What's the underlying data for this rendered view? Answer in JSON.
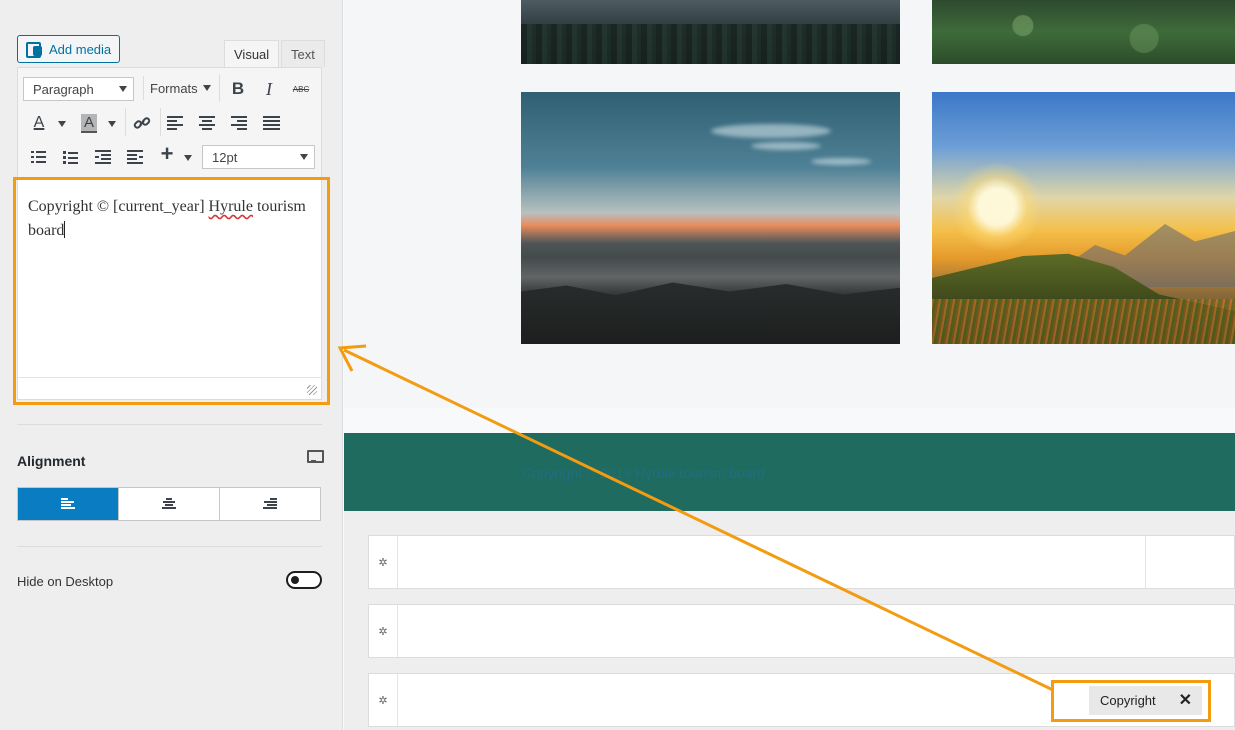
{
  "editor": {
    "add_media_label": "Add media",
    "tabs": [
      {
        "label": "Visual"
      },
      {
        "label": "Text"
      }
    ],
    "toolbar": {
      "paragraph_select": "Paragraph",
      "formats_label": "Formats",
      "font_size_select": "12pt",
      "icons": [
        "bold-icon",
        "italic-icon",
        "strikethrough-icon",
        "text-color-icon",
        "background-color-icon",
        "link-icon",
        "align-left-icon",
        "align-center-icon",
        "align-right-icon",
        "align-justify-icon",
        "ordered-list-icon",
        "bullet-list-icon",
        "outdent-icon",
        "indent-icon",
        "insert-icon"
      ],
      "bold_glyph": "B",
      "italic_glyph": "I",
      "strike_glyph": "ABC",
      "text_color_glyph": "A",
      "bg_color_glyph": "A",
      "insert_glyph": "+"
    },
    "content": {
      "part1": "Copyright © [current_year] ",
      "misspelled": "Hyrule",
      "part2": " tourism board"
    }
  },
  "alignment": {
    "title": "Alignment",
    "options": [
      "left",
      "center",
      "right"
    ],
    "selected": "left"
  },
  "visibility": {
    "hide_on_desktop_label": "Hide on Desktop",
    "hide_on_desktop": false
  },
  "preview": {
    "footer_text": "Copyright © 2019 Hyrule tourism board",
    "chip_label": "Copyright",
    "chip_close": "✕",
    "row_handle_glyph": "✲"
  },
  "colors": {
    "highlight": "#f39c12",
    "accent_blue": "#0a7cc1",
    "footer_band": "#206b5f",
    "link_blue": "#0071a1"
  }
}
